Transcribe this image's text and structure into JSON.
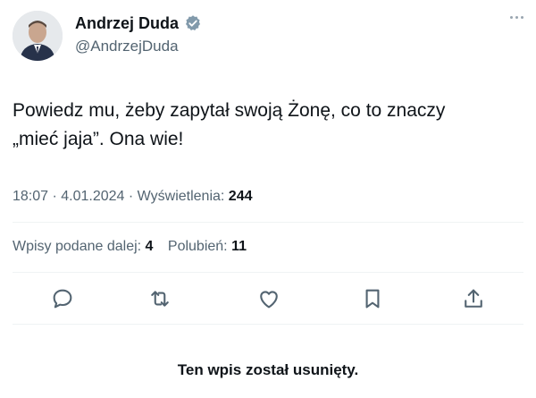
{
  "user": {
    "display_name": "Andrzej Duda",
    "handle": "@AndrzejDuda",
    "verified_icon": "verified-badge-icon",
    "avatar_icon": "avatar-photo"
  },
  "tweet": {
    "text_line1": "Powiedz mu, żeby zapytał swoją Żonę, co to znaczy",
    "text_line2": "„mieć jaja”. Ona wie!",
    "time": "18:07",
    "date": "4.01.2024",
    "views_label": "Wyświetlenia:",
    "views_count": "244"
  },
  "stats": {
    "reposts_label": "Wpisy podane dalej:",
    "reposts_count": "4",
    "likes_label": "Polubień:",
    "likes_count": "11"
  },
  "actions": [
    {
      "name": "reply",
      "icon": "reply-icon"
    },
    {
      "name": "repost",
      "icon": "repost-icon"
    },
    {
      "name": "like",
      "icon": "like-icon"
    },
    {
      "name": "bookmark",
      "icon": "bookmark-icon"
    },
    {
      "name": "share",
      "icon": "share-icon"
    }
  ],
  "notice": {
    "deleted_text": "Ten wpis został usunięty."
  },
  "colors": {
    "text": "#0f1419",
    "secondary": "#536471",
    "verified": "#829aab"
  }
}
